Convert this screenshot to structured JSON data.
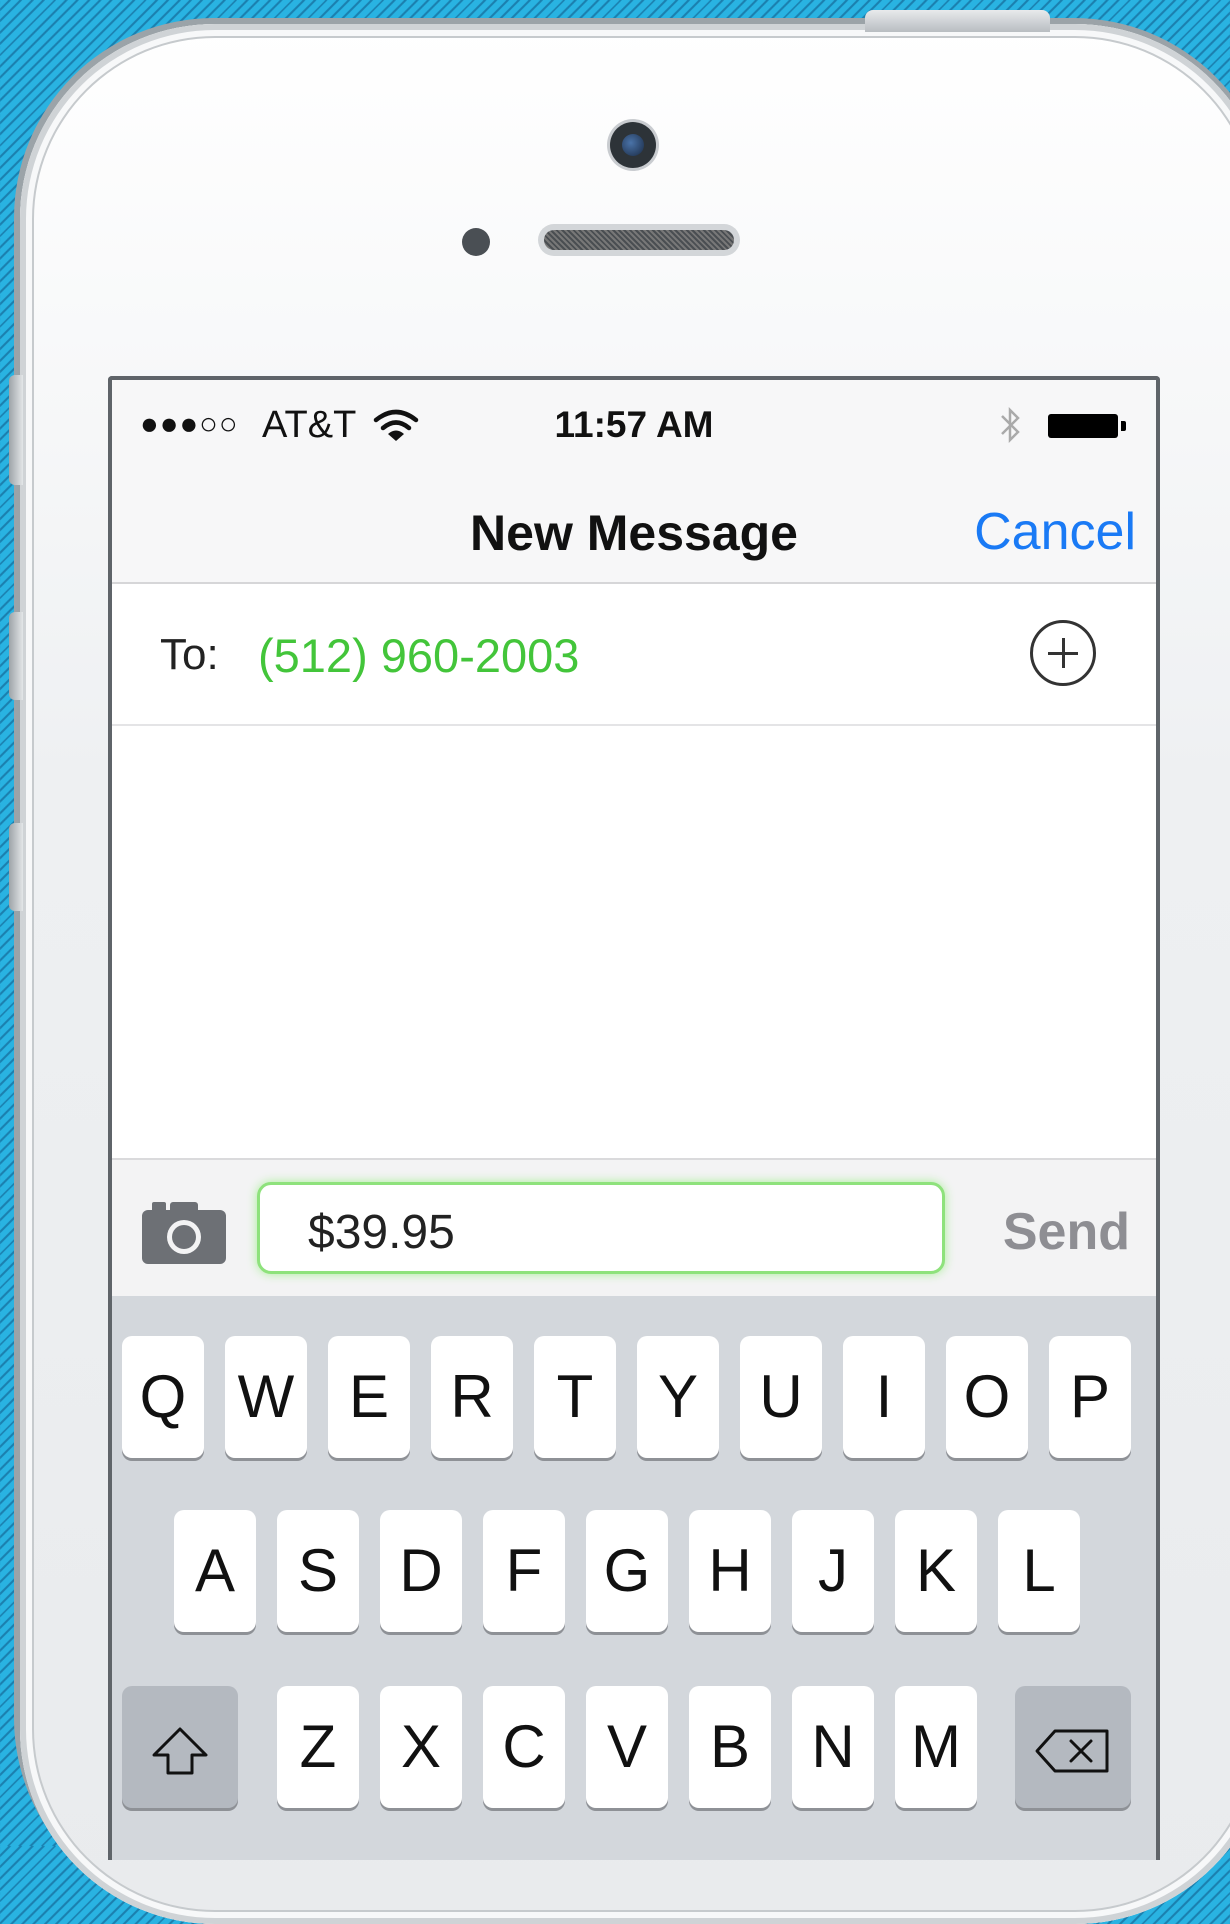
{
  "status_bar": {
    "signal": "●●●○○",
    "carrier": "AT&T",
    "time": "11:57 AM"
  },
  "nav": {
    "title": "New Message",
    "cancel_label": "Cancel"
  },
  "recipient": {
    "label": "To:",
    "number": "(512) 960-2003"
  },
  "compose": {
    "message_value": "$39.95",
    "send_label": "Send"
  },
  "keyboard": {
    "row1": [
      "Q",
      "W",
      "E",
      "R",
      "T",
      "Y",
      "U",
      "I",
      "O",
      "P"
    ],
    "row2": [
      "A",
      "S",
      "D",
      "F",
      "G",
      "H",
      "J",
      "K",
      "L"
    ],
    "row3": [
      "Z",
      "X",
      "C",
      "V",
      "B",
      "N",
      "M"
    ]
  },
  "colors": {
    "accent_blue": "#1a7af5",
    "recipient_green": "#43c53a",
    "field_glow_green": "#8ee27c",
    "background_blue": "#29b3e2"
  },
  "icons": [
    "wifi-icon",
    "bluetooth-icon",
    "battery-icon",
    "add-contact-icon",
    "camera-icon",
    "shift-icon",
    "delete-icon"
  ]
}
